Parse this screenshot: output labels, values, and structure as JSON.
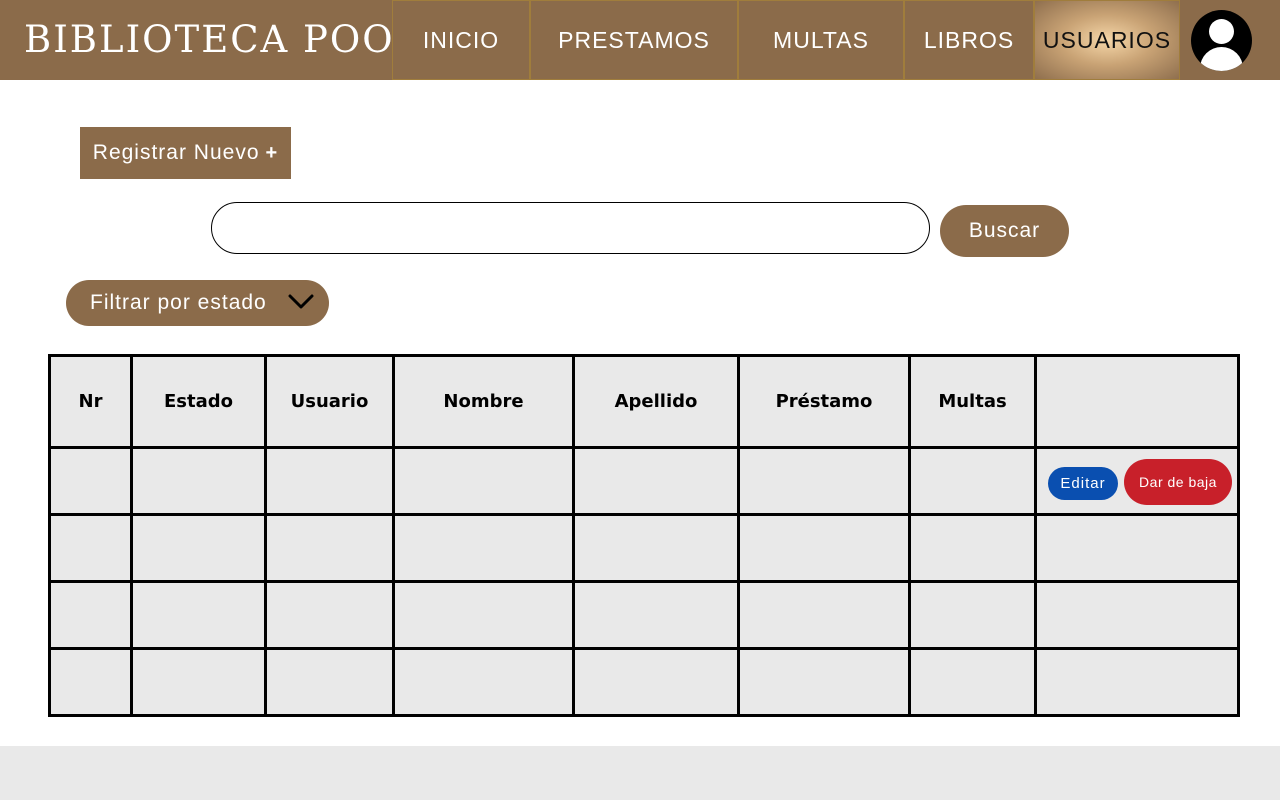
{
  "header": {
    "brand": "BIBLIOTECA POO",
    "nav": [
      {
        "label": "INICIO"
      },
      {
        "label": "PRESTAMOS"
      },
      {
        "label": "MULTAS"
      },
      {
        "label": "LIBROS"
      },
      {
        "label": "USUARIOS",
        "active": true
      }
    ],
    "avatar_icon": "user-avatar-icon"
  },
  "actions": {
    "register_label": "Registrar Nuevo",
    "register_icon": "plus-icon",
    "search_placeholder": "",
    "search_value": "",
    "search_label": "Buscar",
    "filter_label": "Filtrar por estado",
    "filter_icon": "chevron-down-icon"
  },
  "table": {
    "headers": [
      "Nr",
      "Estado",
      "Usuario",
      "Nombre",
      "Apellido",
      "Préstamo",
      "Multas",
      ""
    ],
    "rows": [
      [
        "",
        "",
        "",
        "",
        "",
        "",
        ""
      ],
      [
        "",
        "",
        "",
        "",
        "",
        "",
        ""
      ],
      [
        "",
        "",
        "",
        "",
        "",
        "",
        ""
      ],
      [
        "",
        "",
        "",
        "",
        "",
        "",
        ""
      ]
    ],
    "row_actions": {
      "edit_label": "Editar",
      "delete_label": "Dar de baja"
    }
  },
  "colors": {
    "brand": "#8b6b4a",
    "edit": "#0a4fb0",
    "delete": "#c8202a",
    "table_fill": "#e9e9e9"
  }
}
